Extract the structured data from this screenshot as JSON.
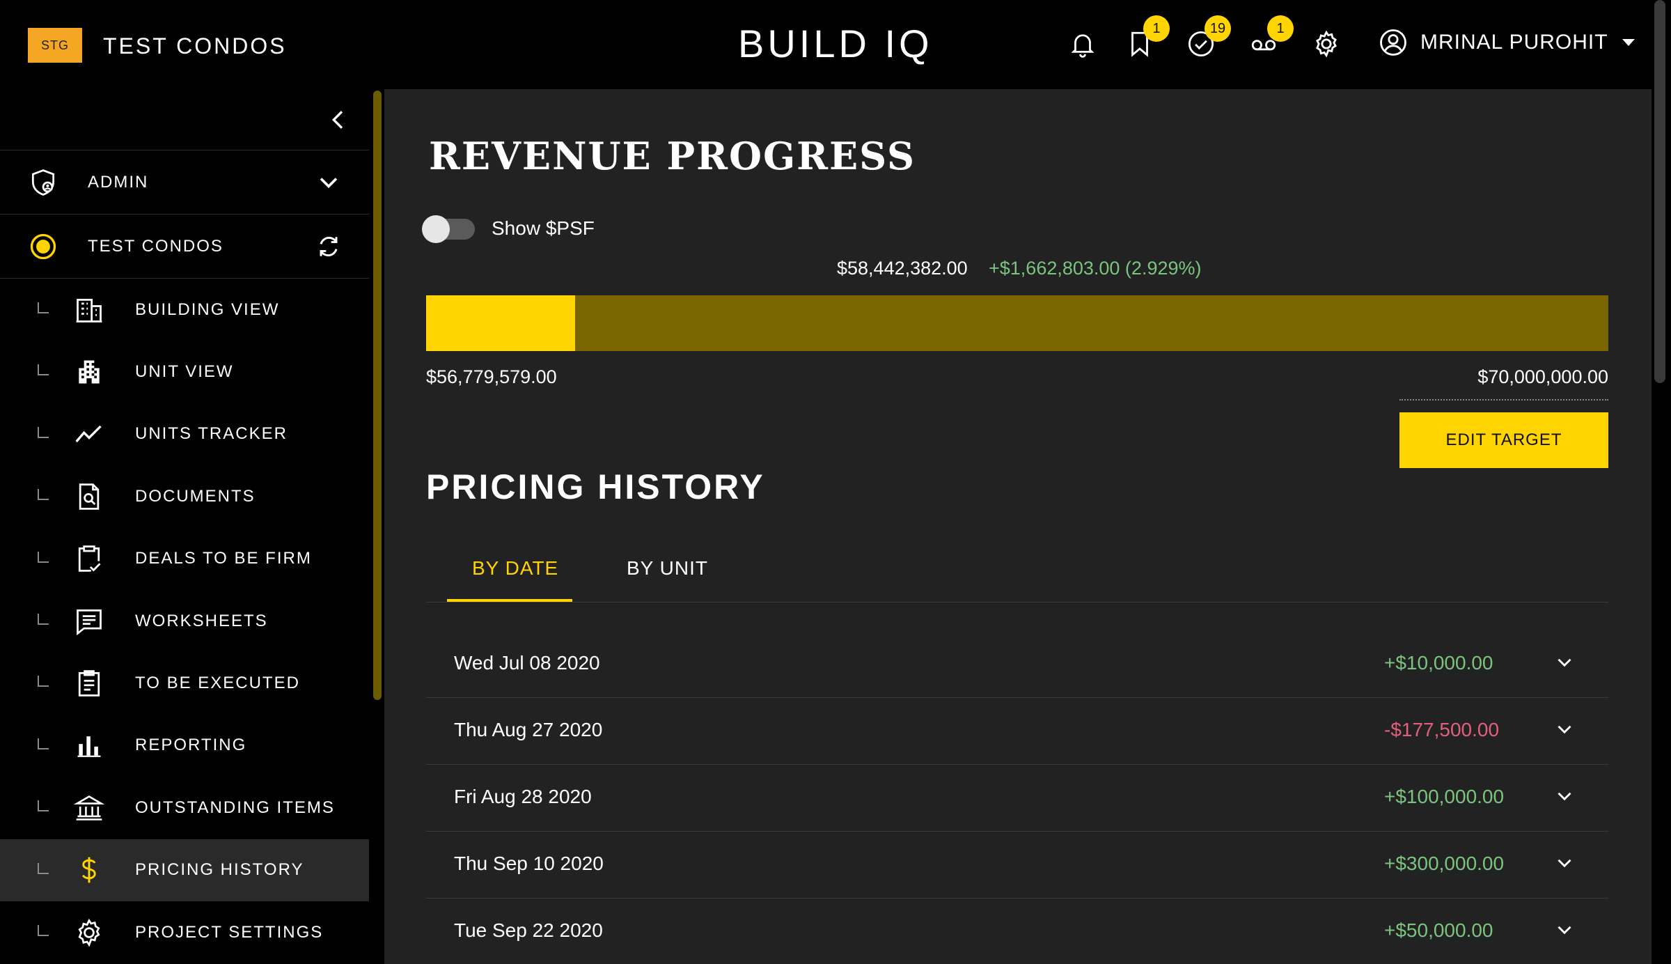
{
  "topbar": {
    "env_badge": "STG",
    "project_name": "TEST CONDOS",
    "brand": "BUILD IQ",
    "icons": [
      {
        "name": "bell-icon",
        "badge": ""
      },
      {
        "name": "bookmark-icon",
        "badge": "1"
      },
      {
        "name": "check-circle-icon",
        "badge": "19"
      },
      {
        "name": "voicemail-icon",
        "badge": "1"
      },
      {
        "name": "gear-icon",
        "badge": ""
      }
    ],
    "user_name": "MRINAL PUROHIT"
  },
  "sidebar": {
    "admin_label": "ADMIN",
    "project_label": "TEST CONDOS",
    "items": [
      {
        "label": "BUILDING VIEW",
        "icon": "building-icon"
      },
      {
        "label": "UNIT VIEW",
        "icon": "apartment-icon"
      },
      {
        "label": "UNITS TRACKER",
        "icon": "trend-line-icon"
      },
      {
        "label": "DOCUMENTS",
        "icon": "document-search-icon"
      },
      {
        "label": "DEALS TO BE FIRM",
        "icon": "clipboard-check-icon"
      },
      {
        "label": "WORKSHEETS",
        "icon": "message-list-icon"
      },
      {
        "label": "TO BE EXECUTED",
        "icon": "clipboard-list-icon"
      },
      {
        "label": "REPORTING",
        "icon": "bar-chart-icon"
      },
      {
        "label": "OUTSTANDING ITEMS",
        "icon": "bank-icon"
      },
      {
        "label": "PRICING HISTORY",
        "icon": "dollar-icon",
        "active": true
      },
      {
        "label": "PROJECT SETTINGS",
        "icon": "gear-icon"
      }
    ]
  },
  "revenue": {
    "title": "REVENUE PROGRESS",
    "toggle_label": "Show $PSF",
    "toggle_on": false,
    "current_value": "$58,442,382.00",
    "change": "+$1,662,803.00 (2.929%)",
    "start_value": "$56,779,579.00",
    "target_value": "$70,000,000.00",
    "progress_fraction": 0.126,
    "edit_target_label": "EDIT TARGET"
  },
  "pricing_history": {
    "title": "PRICING HISTORY",
    "tabs": [
      {
        "label": "BY DATE",
        "active": true
      },
      {
        "label": "BY UNIT",
        "active": false
      }
    ],
    "rows": [
      {
        "date": "Wed Jul 08 2020",
        "amount": "+$10,000.00",
        "sign": "pos"
      },
      {
        "date": "Thu Aug 27 2020",
        "amount": "-$177,500.00",
        "sign": "neg"
      },
      {
        "date": "Fri Aug 28 2020",
        "amount": "+$100,000.00",
        "sign": "pos"
      },
      {
        "date": "Thu Sep 10 2020",
        "amount": "+$300,000.00",
        "sign": "pos"
      },
      {
        "date": "Tue Sep 22 2020",
        "amount": "+$50,000.00",
        "sign": "pos"
      }
    ]
  },
  "colors": {
    "accent": "#ffd400",
    "progress_track": "#7a6600",
    "positive": "#7bc47f",
    "negative": "#e0607e",
    "env_badge": "#f5a623"
  }
}
